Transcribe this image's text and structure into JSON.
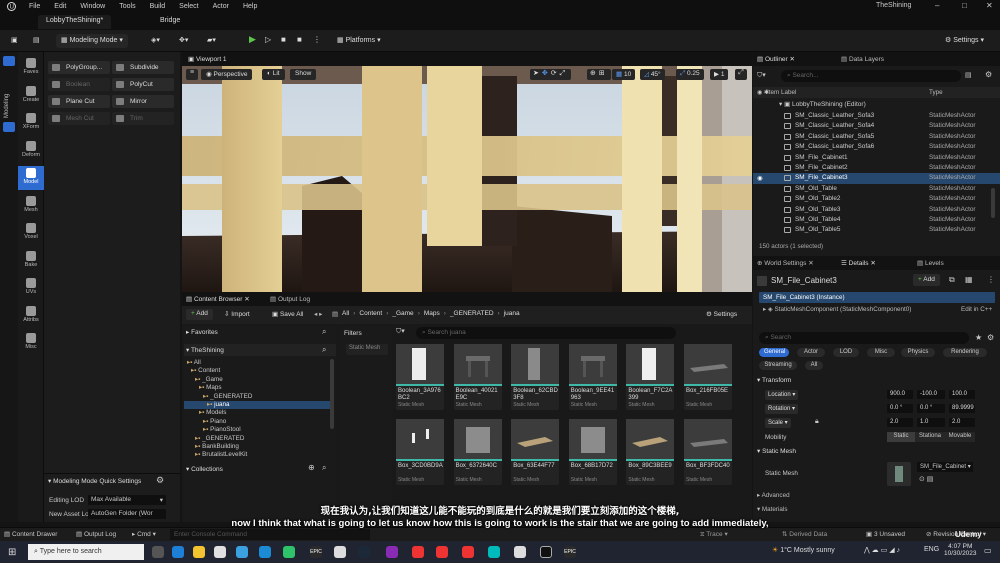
{
  "menu": [
    "File",
    "Edit",
    "Window",
    "Tools",
    "Build",
    "Select",
    "Actor",
    "Help"
  ],
  "window_title": "TheShining",
  "tabs": {
    "level": "LobbyTheShining*",
    "bridge": "Bridge"
  },
  "toolbar": {
    "mode": "Modeling Mode",
    "platforms": "Platforms",
    "settings": "Settings"
  },
  "categories": [
    "Faves",
    "Create",
    "XForm",
    "Deform",
    "Model",
    "Mesh",
    "Voxel",
    "Bake",
    "UVs",
    "Attribs",
    "Misc"
  ],
  "modes_label": "Modeling",
  "tools": [
    {
      "label": "PolyGroup...",
      "dim": false
    },
    {
      "label": "Subdivide",
      "dim": false
    },
    {
      "label": "Boolean",
      "dim": true
    },
    {
      "label": "PolyCut",
      "dim": false
    },
    {
      "label": "Plane Cut",
      "dim": false
    },
    {
      "label": "Mirror",
      "dim": false
    },
    {
      "label": "Mesh Cut",
      "dim": true
    },
    {
      "label": "Trim",
      "dim": true
    }
  ],
  "quick_settings": {
    "title": "Modeling Mode Quick Settings",
    "editing_lod_label": "Editing LOD",
    "editing_lod_value": "Max Available",
    "new_asset_label": "New Asset Lo",
    "new_asset_value": "AutoGen Folder (Wor"
  },
  "viewport": {
    "tab": "Viewport 1",
    "view": "Perspective",
    "lit": "Lit",
    "show": "Show",
    "grid": "10",
    "angle": "45°",
    "scale": "0.25",
    "speed": "1"
  },
  "content_browser": {
    "tab": "Content Browser",
    "output_tab": "Output Log",
    "add": "Add",
    "import": "Import",
    "save_all": "Save All",
    "path": [
      "All",
      "Content",
      "_Game",
      "Maps",
      "_GENERATED",
      "juana"
    ],
    "settings": "Settings",
    "favorites": "Favorites",
    "project": "TheShining",
    "filters": "Filters",
    "search_placeholder": "Search juana",
    "static_mesh_chip": "Static Mesh",
    "collections": "Collections",
    "tree": [
      {
        "label": "All",
        "indent": 0
      },
      {
        "label": "Content",
        "indent": 1
      },
      {
        "label": "_Game",
        "indent": 2
      },
      {
        "label": "Maps",
        "indent": 3
      },
      {
        "label": "_GENERATED",
        "indent": 4
      },
      {
        "label": "juana",
        "indent": 5,
        "selected": true
      },
      {
        "label": "Models",
        "indent": 3
      },
      {
        "label": "Piano",
        "indent": 4
      },
      {
        "label": "PianoStool",
        "indent": 4
      },
      {
        "label": "_GENERATED",
        "indent": 2
      },
      {
        "label": "BankBuilding",
        "indent": 2
      },
      {
        "label": "BrutalistLevelKit",
        "indent": 2
      }
    ],
    "assets": [
      {
        "name": "Boolean_3A976BC2",
        "type": "Static Mesh",
        "shape": "tall"
      },
      {
        "name": "Boolean_40021E9C",
        "type": "Static Mesh",
        "shape": "table"
      },
      {
        "name": "Boolean_62CBD3F8",
        "type": "Static Mesh",
        "shape": "tallgrey"
      },
      {
        "name": "Boolean_9EE41963",
        "type": "Static Mesh",
        "shape": "table"
      },
      {
        "name": "Boolean_F7C2A399",
        "type": "Static Mesh",
        "shape": "tall"
      },
      {
        "name": "Box_216FB05E",
        "type": "Static Mesh",
        "shape": "flat"
      },
      {
        "name": "Box_3CD0BD9A",
        "type": "Static Mesh",
        "shape": "posts"
      },
      {
        "name": "Box_6372640C",
        "type": "Static Mesh",
        "shape": "cube"
      },
      {
        "name": "Box_63E44F77",
        "type": "Static Mesh",
        "shape": "plank"
      },
      {
        "name": "Box_68B17D72",
        "type": "Static Mesh",
        "shape": "cube"
      },
      {
        "name": "Box_89C3BEE9",
        "type": "Static Mesh",
        "shape": "plank"
      },
      {
        "name": "Box_BF3FDC40",
        "type": "Static Mesh",
        "shape": "flat"
      }
    ]
  },
  "outliner": {
    "tab": "Outliner",
    "layers_tab": "Data Layers",
    "search_placeholder": "Search...",
    "col_label": "Item Label",
    "col_type": "Type",
    "root": "LobbyTheShining (Editor)",
    "rows": [
      {
        "name": "SM_Classic_Leather_Sofa3",
        "type": "StaticMeshActor"
      },
      {
        "name": "SM_Classic_Leather_Sofa4",
        "type": "StaticMeshActor"
      },
      {
        "name": "SM_Classic_Leather_Sofa5",
        "type": "StaticMeshActor"
      },
      {
        "name": "SM_Classic_Leather_Sofa6",
        "type": "StaticMeshActor"
      },
      {
        "name": "SM_File_Cabinet1",
        "type": "StaticMeshActor"
      },
      {
        "name": "SM_File_Cabinet2",
        "type": "StaticMeshActor"
      },
      {
        "name": "SM_File_Cabinet3",
        "type": "StaticMeshActor",
        "selected": true
      },
      {
        "name": "SM_Old_Table",
        "type": "StaticMeshActor"
      },
      {
        "name": "SM_Old_Table2",
        "type": "StaticMeshActor"
      },
      {
        "name": "SM_Old_Table3",
        "type": "StaticMeshActor"
      },
      {
        "name": "SM_Old_Table4",
        "type": "StaticMeshActor"
      },
      {
        "name": "SM_Old_Table5",
        "type": "StaticMeshActor"
      }
    ],
    "count": "150 actors (1 selected)"
  },
  "details": {
    "world_tab": "World Settings",
    "details_tab": "Details",
    "levels_tab": "Levels",
    "actor": "SM_File_Cabinet3",
    "add": "Add",
    "instance": "SM_File_Cabinet3 (Instance)",
    "component": "StaticMeshComponent (StaticMeshComponent0)",
    "edit_cpp": "Edit in C++",
    "search_placeholder": "Search",
    "filters": [
      "General",
      "Actor",
      "LOD",
      "Misc",
      "Physics",
      "Rendering",
      "Streaming",
      "All"
    ],
    "transform": "Transform",
    "location": {
      "label": "Location",
      "x": "900.0",
      "y": "-100.0",
      "z": "100.0"
    },
    "rotation": {
      "label": "Rotation",
      "x": "0.0 °",
      "y": "0.0 °",
      "z": "89.9999"
    },
    "scale": {
      "label": "Scale",
      "x": "2.0",
      "y": "1.0",
      "z": "2.0"
    },
    "mobility": {
      "label": "Mobility",
      "options": [
        "Static",
        "Stationa",
        "Movable"
      ]
    },
    "static_mesh_section": "Static Mesh",
    "static_mesh_label": "Static Mesh",
    "static_mesh_value": "SM_File_Cabinet",
    "advanced": "Advanced",
    "materials": "Materials"
  },
  "status": {
    "content_drawer": "Content Drawer",
    "output_log": "Output Log",
    "cmd": "Cmd",
    "console_placeholder": "Enter Console Command",
    "trace": "Trace",
    "derived": "Derived Data",
    "unsaved": "3 Unsaved",
    "revision": "Revision Control"
  },
  "taskbar": {
    "search_placeholder": "Type here to search",
    "weather": "1°C  Mostly sunny",
    "lang": "ENG",
    "time": "4:07 PM",
    "date": "10/30/2023"
  },
  "subtitles": {
    "zh": "现在我认为,让我们知道这儿能不能玩的到底是什么的就是我们要立刻添加的这个楼梯,",
    "en": "now I think that what is going to let us know how this is going to work is the stair that we are going to add immediately,"
  },
  "watermark": "Udemy",
  "colors": {
    "accent": "#2f6cd1",
    "selection": "#26486e",
    "teal": "#3fb8a8",
    "play": "#5dc54a"
  }
}
